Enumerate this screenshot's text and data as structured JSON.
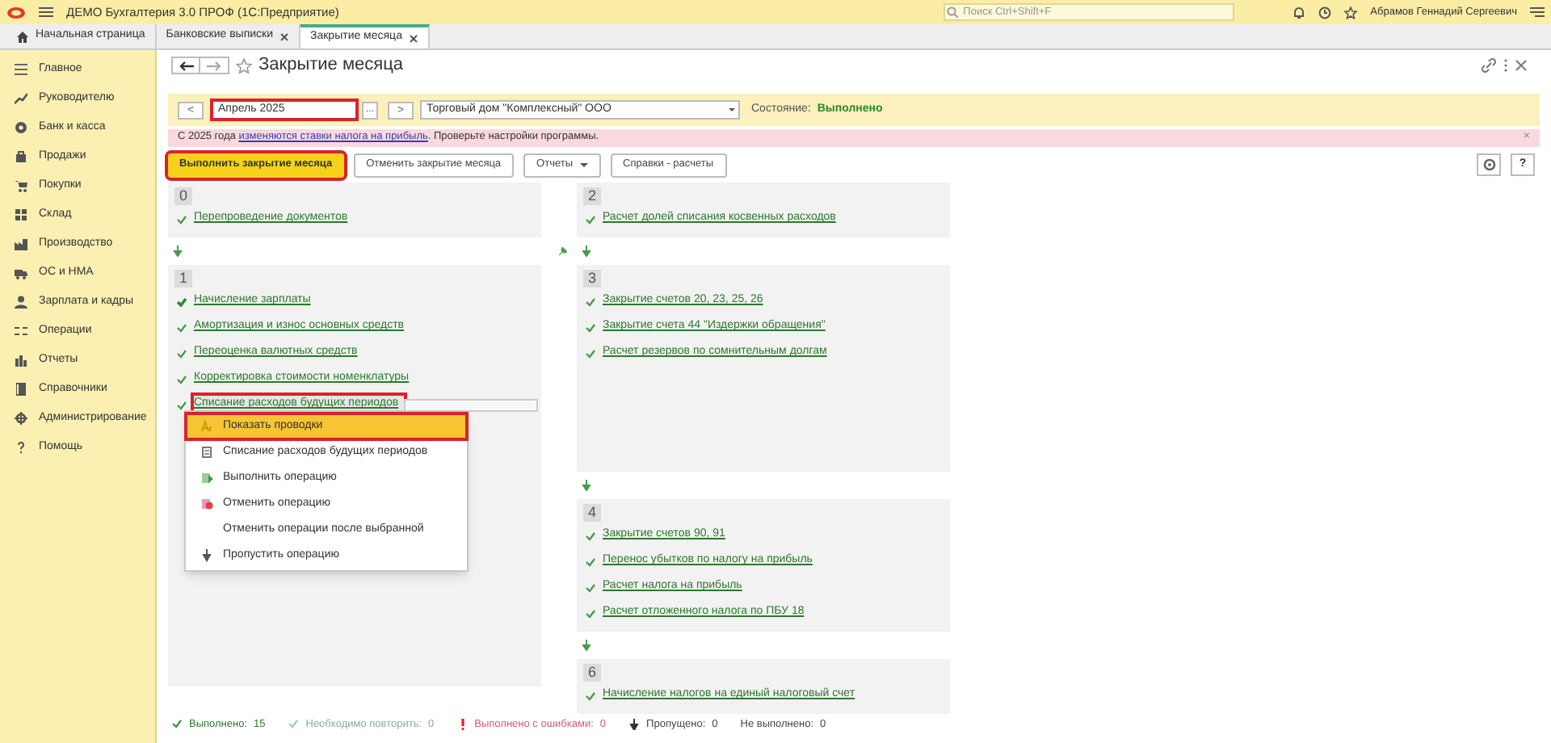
{
  "app": {
    "title": "ДЕМО Бухгалтерия 3.0 ПРОФ  (1С:Предприятие)",
    "search": {
      "placeholder": "Поиск Ctrl+Shift+F"
    },
    "user": "Абрамов Геннадий Сергеевич"
  },
  "tabs": [
    {
      "label": "Начальная страница",
      "selected": false,
      "closable": false
    },
    {
      "label": "Банковские выписки",
      "selected": false,
      "closable": true
    },
    {
      "label": "Закрытие месяца",
      "selected": true,
      "closable": true
    }
  ],
  "sidebar": {
    "items": [
      {
        "label": "Главное"
      },
      {
        "label": "Руководителю"
      },
      {
        "label": "Банк и касса"
      },
      {
        "label": "Продажи"
      },
      {
        "label": "Покупки"
      },
      {
        "label": "Склад"
      },
      {
        "label": "Производство"
      },
      {
        "label": "ОС и НМА"
      },
      {
        "label": "Зарплата и кадры"
      },
      {
        "label": "Операции"
      },
      {
        "label": "Отчеты"
      },
      {
        "label": "Справочники"
      },
      {
        "label": "Администрирование"
      },
      {
        "label": "Помощь"
      }
    ]
  },
  "form": {
    "title": "Закрытие месяца",
    "period": {
      "prev": "<",
      "value": "Апрель 2025",
      "choose": "...",
      "next": ">",
      "highlighted": true
    },
    "organization": "Торговый дом \"Комплексный\" ООО",
    "state_label": "Состояние:",
    "state_value": "Выполнено",
    "notice": {
      "before": "С 2025 года ",
      "link": "изменяются ставки налога на прибыль",
      "after": ". Проверьте настройки программы.",
      "close": "×"
    },
    "buttons": [
      {
        "label": "Выполнить закрытие месяца",
        "primary": true,
        "highlighted": true,
        "dropdown": false
      },
      {
        "label": "Отменить закрытие месяца",
        "primary": false,
        "highlighted": false,
        "dropdown": false
      },
      {
        "label": "Отчеты",
        "primary": false,
        "highlighted": false,
        "dropdown": true
      },
      {
        "label": "Справки - расчеты",
        "primary": false,
        "highlighted": false,
        "dropdown": false
      }
    ],
    "help": "?"
  },
  "left_groups": [
    {
      "number": "0",
      "items": [
        {
          "label": "Перепроведение документов",
          "kind": "done",
          "selected": false
        }
      ]
    },
    {
      "number": "1",
      "items": [
        {
          "label": "Начисление зарплаты",
          "kind": "changed",
          "selected": false
        },
        {
          "label": "Амортизация и износ основных средств",
          "kind": "done",
          "selected": false
        },
        {
          "label": "Переоценка валютных средств",
          "kind": "done",
          "selected": false
        },
        {
          "label": "Корректировка стоимости номенклатуры",
          "kind": "done",
          "selected": false
        },
        {
          "label": "Списание расходов будущих периодов",
          "kind": "done",
          "selected": true
        }
      ]
    }
  ],
  "right_groups": [
    {
      "number": "2",
      "items": [
        {
          "label": "Расчет долей списания косвенных расходов",
          "kind": "done",
          "selected": false
        }
      ]
    },
    {
      "number": "3",
      "items": [
        {
          "label": "Закрытие счетов 20, 23, 25, 26",
          "kind": "done",
          "selected": false
        },
        {
          "label": "Закрытие счета 44 \"Издержки обращения\"",
          "kind": "done",
          "selected": false
        },
        {
          "label": "Расчет резервов по сомнительным долгам",
          "kind": "done",
          "selected": false
        }
      ]
    },
    {
      "number": "4",
      "items": [
        {
          "label": "Закрытие счетов 90, 91",
          "kind": "done",
          "selected": false
        },
        {
          "label": "Перенос убытков по налогу на прибыль",
          "kind": "done",
          "selected": false
        },
        {
          "label": "Расчет налога на прибыль",
          "kind": "done",
          "selected": false
        },
        {
          "label": "Расчет отложенного налога по ПБУ 18",
          "kind": "done",
          "selected": false
        }
      ]
    },
    {
      "number": "6",
      "items": [
        {
          "label": "Начисление налогов на единый налоговый счет",
          "kind": "done",
          "selected": false
        }
      ]
    }
  ],
  "context_menu": [
    {
      "label": "Показать проводки",
      "kind": "postings",
      "selected": true,
      "highlighted": true
    },
    {
      "label": "Списание расходов будущих периодов",
      "kind": "document",
      "selected": false,
      "highlighted": false
    },
    {
      "label": "Выполнить операцию",
      "kind": "run",
      "selected": false,
      "highlighted": false
    },
    {
      "label": "Отменить операцию",
      "kind": "cancel",
      "selected": false,
      "highlighted": false
    },
    {
      "label": "Отменить операции после выбранной",
      "kind": "none",
      "selected": false,
      "highlighted": false
    },
    {
      "label": "Пропустить операцию",
      "kind": "skip",
      "selected": false,
      "highlighted": false
    }
  ],
  "status_bar": [
    {
      "kind": "done",
      "label": "Выполнено:",
      "count": "15"
    },
    {
      "kind": "repeat",
      "label": "Необходимо повторить:",
      "count": "0"
    },
    {
      "kind": "error",
      "label": "Выполнено с ошибками:",
      "count": "0"
    },
    {
      "kind": "skipped",
      "label": "Пропущено:",
      "count": "0"
    },
    {
      "kind": "not_done",
      "label": "Не выполнено:",
      "count": "0"
    }
  ]
}
